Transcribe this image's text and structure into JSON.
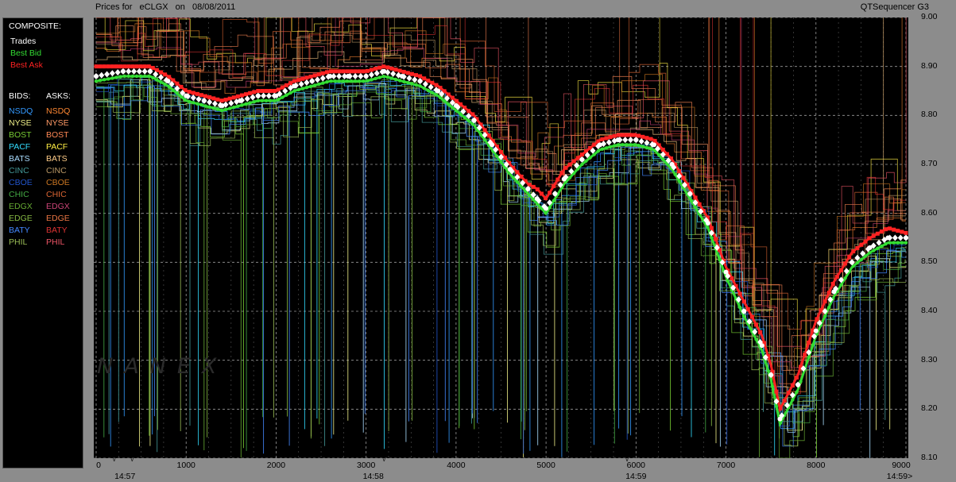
{
  "header": {
    "prefix": "Prices for",
    "symbol": "eCLGX",
    "on": "on",
    "date": "08/08/2011",
    "app": "QTSequencer G3"
  },
  "legend": {
    "composite_label": "COMPOSITE:",
    "composite": [
      {
        "label": "Trades",
        "color": "#ffffff"
      },
      {
        "label": "Best Bid",
        "color": "#33dd33"
      },
      {
        "label": "Best Ask",
        "color": "#ff2222"
      }
    ],
    "bids_label": "BIDS:",
    "asks_label": "ASKS:",
    "exchanges": [
      {
        "bid": "NSDQ",
        "bid_color": "#3399ff",
        "ask": "NSDQ",
        "ask_color": "#ff8833"
      },
      {
        "bid": "NYSE",
        "bid_color": "#eeee88",
        "ask": "NYSE",
        "ask_color": "#ff9966"
      },
      {
        "bid": "BOST",
        "bid_color": "#77cc33",
        "ask": "BOST",
        "ask_color": "#ff8855"
      },
      {
        "bid": "PACF",
        "bid_color": "#33ddff",
        "ask": "PACF",
        "ask_color": "#ffee44"
      },
      {
        "bid": "BATS",
        "bid_color": "#aaddff",
        "ask": "BATS",
        "ask_color": "#ffcc88"
      },
      {
        "bid": "CINC",
        "bid_color": "#449999",
        "ask": "CINC",
        "ask_color": "#bb9966"
      },
      {
        "bid": "CBOE",
        "bid_color": "#2255cc",
        "ask": "CBOE",
        "ask_color": "#cc7722"
      },
      {
        "bid": "CHIC",
        "bid_color": "#44aa44",
        "ask": "CHIC",
        "ask_color": "#dd6633"
      },
      {
        "bid": "EDGX",
        "bid_color": "#66aa33",
        "ask": "EDGX",
        "ask_color": "#cc4477"
      },
      {
        "bid": "EDGE",
        "bid_color": "#88bb44",
        "ask": "EDGE",
        "ask_color": "#ee7744"
      },
      {
        "bid": "BATY",
        "bid_color": "#4488ff",
        "ask": "BATY",
        "ask_color": "#dd3333"
      },
      {
        "bid": "PHIL",
        "bid_color": "#99bb55",
        "ask": "PHIL",
        "ask_color": "#ee5566"
      }
    ]
  },
  "watermark": "NANEX",
  "chart_data": {
    "type": "line",
    "title": "Prices for eCLGX on 08/08/2011",
    "xlim": [
      0,
      9000
    ],
    "ylim": [
      8.1,
      9.0
    ],
    "x_ticks": [
      0,
      1000,
      2000,
      3000,
      4000,
      5000,
      6000,
      7000,
      8000,
      9000
    ],
    "x_tick_labels": [
      "0",
      "1000",
      "2000",
      "3000",
      "4000",
      "5000",
      "6000",
      "7000",
      "8000",
      "9000"
    ],
    "y_ticks": [
      8.1,
      8.2,
      8.3,
      8.4,
      8.5,
      8.6,
      8.7,
      8.8,
      8.9,
      9.0
    ],
    "y_tick_labels": [
      "8.10",
      "8.20",
      "8.30",
      "8.40",
      "8.50",
      "8.60",
      "8.70",
      "8.80",
      "8.90",
      "9.00"
    ],
    "time_labels": [
      {
        "x": 320,
        "label": "14:57"
      },
      {
        "x": 3080,
        "label": "14:58"
      },
      {
        "x": 6000,
        "label": "14:59"
      },
      {
        "x": 9000,
        "label": "14:59>"
      }
    ],
    "time_marker_x": [
      200,
      400,
      3200,
      5900
    ],
    "grid": true,
    "series": [
      {
        "name": "Trades",
        "color": "#ffffff",
        "x": [
          0,
          300,
          600,
          800,
          1000,
          1200,
          1400,
          1600,
          1800,
          2000,
          2200,
          2400,
          2600,
          2800,
          3000,
          3200,
          3400,
          3600,
          3800,
          4000,
          4200,
          4400,
          4600,
          4800,
          4900,
          5000,
          5100,
          5200,
          5400,
          5600,
          5800,
          6000,
          6200,
          6400,
          6600,
          6800,
          7000,
          7200,
          7400,
          7500,
          7600,
          7800,
          8000,
          8200,
          8400,
          8600,
          8800,
          9000
        ],
        "y": [
          8.88,
          8.89,
          8.89,
          8.87,
          8.84,
          8.83,
          8.82,
          8.83,
          8.84,
          8.84,
          8.86,
          8.87,
          8.88,
          8.88,
          8.88,
          8.89,
          8.88,
          8.87,
          8.85,
          8.82,
          8.79,
          8.74,
          8.69,
          8.65,
          8.63,
          8.61,
          8.64,
          8.67,
          8.71,
          8.74,
          8.75,
          8.75,
          8.74,
          8.7,
          8.64,
          8.58,
          8.48,
          8.4,
          8.33,
          8.27,
          8.18,
          8.25,
          8.36,
          8.44,
          8.5,
          8.53,
          8.55,
          8.55
        ]
      },
      {
        "name": "Best Bid",
        "color": "#33dd33",
        "x": [
          0,
          300,
          600,
          800,
          1000,
          1200,
          1400,
          1600,
          1800,
          2000,
          2200,
          2400,
          2600,
          2800,
          3000,
          3200,
          3400,
          3600,
          3800,
          4000,
          4200,
          4400,
          4600,
          4800,
          4900,
          5000,
          5100,
          5200,
          5400,
          5600,
          5800,
          6000,
          6200,
          6400,
          6600,
          6800,
          7000,
          7200,
          7400,
          7500,
          7600,
          7800,
          8000,
          8200,
          8400,
          8600,
          8800,
          9000
        ],
        "y": [
          8.87,
          8.88,
          8.88,
          8.86,
          8.83,
          8.82,
          8.81,
          8.82,
          8.83,
          8.83,
          8.85,
          8.86,
          8.87,
          8.87,
          8.87,
          8.88,
          8.87,
          8.86,
          8.84,
          8.81,
          8.78,
          8.73,
          8.68,
          8.64,
          8.62,
          8.6,
          8.63,
          8.66,
          8.7,
          8.73,
          8.74,
          8.74,
          8.73,
          8.69,
          8.63,
          8.57,
          8.47,
          8.39,
          8.32,
          8.26,
          8.17,
          8.24,
          8.35,
          8.43,
          8.49,
          8.52,
          8.54,
          8.54
        ]
      },
      {
        "name": "Best Ask",
        "color": "#ff2222",
        "x": [
          0,
          300,
          600,
          800,
          1000,
          1200,
          1400,
          1600,
          1800,
          2000,
          2200,
          2400,
          2600,
          2800,
          3000,
          3200,
          3400,
          3600,
          3800,
          4000,
          4200,
          4400,
          4600,
          4800,
          4900,
          5000,
          5100,
          5200,
          5400,
          5600,
          5800,
          6000,
          6200,
          6400,
          6600,
          6800,
          7000,
          7200,
          7400,
          7500,
          7600,
          7800,
          8000,
          8200,
          8400,
          8600,
          8800,
          9000
        ],
        "y": [
          8.9,
          8.9,
          8.9,
          8.88,
          8.85,
          8.84,
          8.83,
          8.84,
          8.85,
          8.85,
          8.87,
          8.88,
          8.89,
          8.89,
          8.89,
          8.9,
          8.89,
          8.88,
          8.86,
          8.83,
          8.8,
          8.75,
          8.7,
          8.66,
          8.65,
          8.63,
          8.66,
          8.69,
          8.72,
          8.75,
          8.76,
          8.76,
          8.75,
          8.71,
          8.65,
          8.59,
          8.49,
          8.42,
          8.35,
          8.29,
          8.2,
          8.27,
          8.38,
          8.46,
          8.52,
          8.55,
          8.57,
          8.56
        ]
      }
    ]
  }
}
